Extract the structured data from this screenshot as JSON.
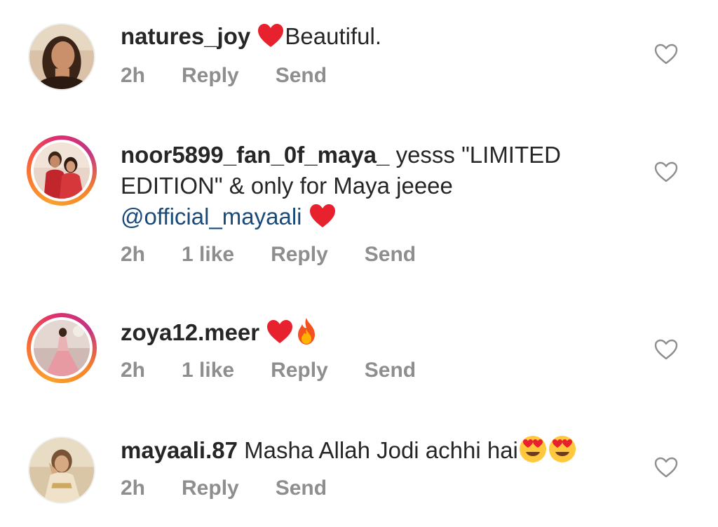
{
  "comments": [
    {
      "username": "natures_joy",
      "text_after": "Beautiful.",
      "time": "2h",
      "reply": "Reply",
      "send": "Send",
      "avatar_icon": "profile-photo-woman",
      "story_ring": false
    },
    {
      "username": "noor5899_fan_0f_maya_",
      "text_line1": "yesss \"LIMITED",
      "text_line2": "EDITION\" & only for Maya jeeee",
      "mention": "@official_mayaali",
      "time": "2h",
      "likes": "1 like",
      "reply": "Reply",
      "send": "Send",
      "avatar_icon": "profile-photo-couple",
      "story_ring": true
    },
    {
      "username": "zoya12.meer",
      "time": "2h",
      "likes": "1 like",
      "reply": "Reply",
      "send": "Send",
      "avatar_icon": "profile-photo-dress",
      "story_ring": true
    },
    {
      "username": "mayaali.87",
      "text": "Masha Allah Jodi achhi hai",
      "time": "2h",
      "reply": "Reply",
      "send": "Send",
      "avatar_icon": "profile-photo-woman-posing",
      "story_ring": false
    }
  ],
  "colors": {
    "username": "#262626",
    "meta": "#8e8e8e",
    "mention": "#1a4a7a",
    "heart": "#e8212f",
    "like_outline": "#8e8e8e"
  }
}
